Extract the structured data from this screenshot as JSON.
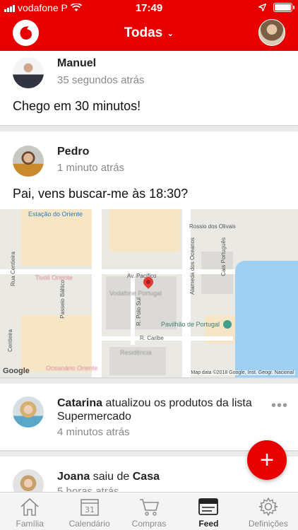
{
  "status": {
    "carrier": "vodafone P",
    "time": "17:49"
  },
  "header": {
    "filter": "Todas",
    "filter_chevron": "⌄"
  },
  "feed": [
    {
      "name": "Manuel",
      "time": "35 segundos atrás",
      "message": "Chego em 30 minutos!"
    },
    {
      "name": "Pedro",
      "time": "1 minuto atrás",
      "message": "Pai, vens buscar-me às 18:30?"
    },
    {
      "name": "Catarina",
      "action": " atualizou os produtos da lista",
      "action_line2": "Supermercado",
      "time": "4 minutos atrás",
      "more": "•••"
    },
    {
      "name": "Joana",
      "action": " saiu de ",
      "place": "Casa",
      "time": "5 horas atrás"
    }
  ],
  "map": {
    "labels": {
      "estacao": "Estação do Oriente",
      "rossio": "Rossio dos Olivais",
      "alameda": "Alameda dos Oceanos",
      "cais": "Cais Português",
      "pacifico": "Av. Pacífico",
      "polo_sul": "R. Polo Sul",
      "caribe": "R. Caribe",
      "pavilhao": "Pavilhão de Portugal",
      "centieira": "Rua Centieira",
      "passeio": "Passeio Báltico",
      "centieira2": "Centieira",
      "blur1": "Vodafone Portugal",
      "blur2": "Tivoli Oriente",
      "blur3": "Residência",
      "blur4": "Oceanário Oriente"
    },
    "google": "Google",
    "attribution": "Map data ©2018 Google, Inst. Geogr. Nacional"
  },
  "fab": {
    "label": "+"
  },
  "tabs": [
    {
      "label": "Família",
      "icon": "house-icon"
    },
    {
      "label": "Calendário",
      "icon": "calendar-icon",
      "day": "31"
    },
    {
      "label": "Compras",
      "icon": "cart-icon"
    },
    {
      "label": "Feed",
      "icon": "feed-icon",
      "active": true
    },
    {
      "label": "Definições",
      "icon": "gear-icon"
    }
  ],
  "colors": {
    "brand": "#e60000",
    "muted": "#8a8a8a"
  }
}
